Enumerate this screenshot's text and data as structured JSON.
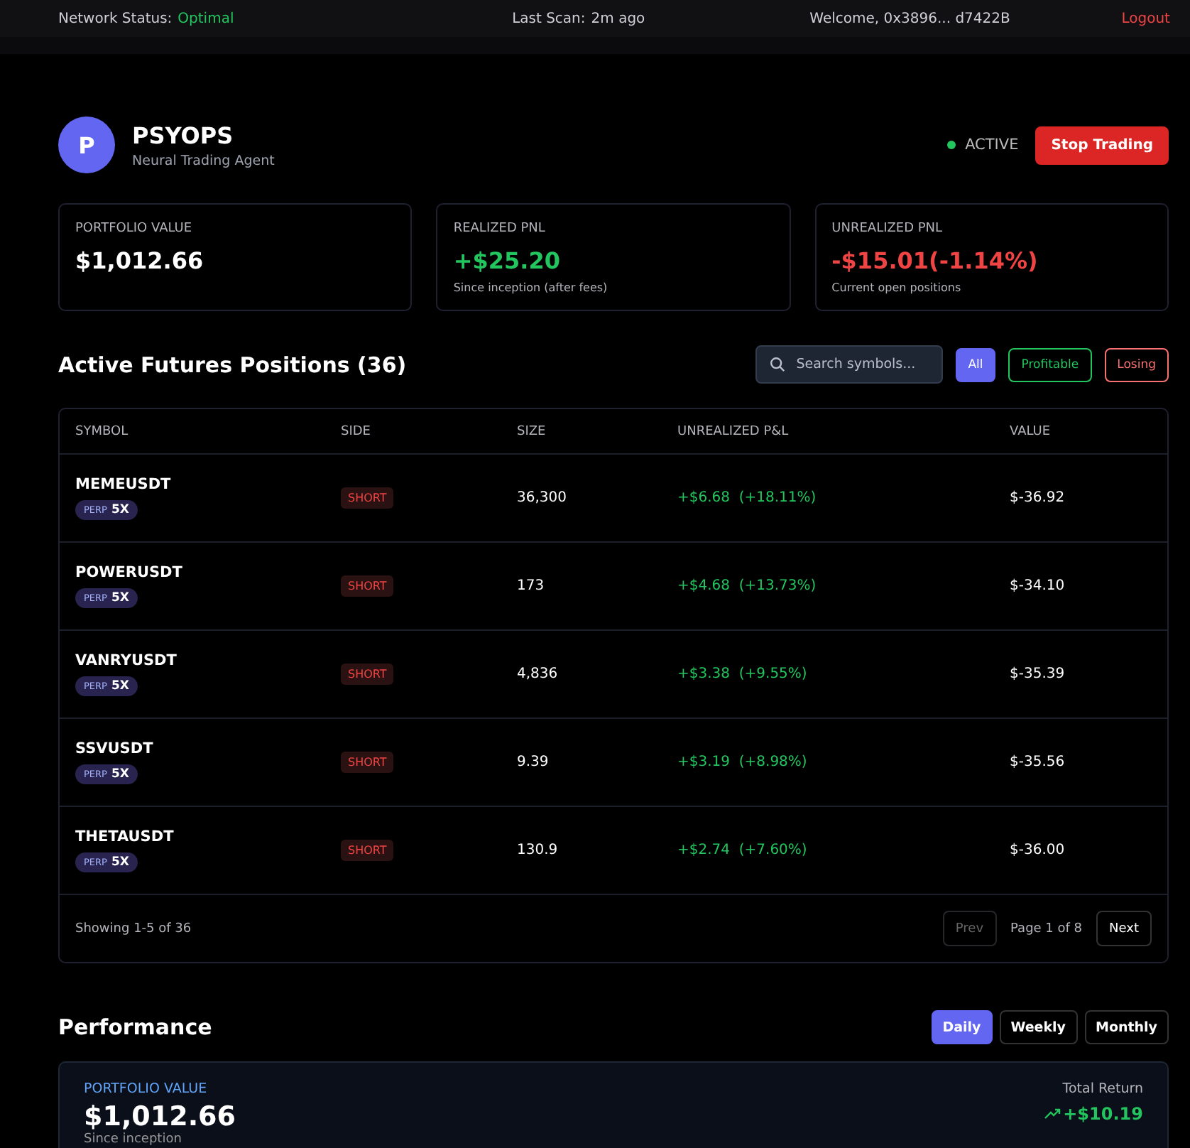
{
  "status_bar": {
    "network_label": "Network Status:",
    "network_value": "Optimal",
    "scan_label": "Last Scan:",
    "scan_value": "2m ago",
    "welcome": "Welcome, 0x3896... d7422B",
    "logout": "Logout"
  },
  "agent": {
    "initial": "P",
    "name": "PSYOPS",
    "subtitle": "Neural Trading Agent",
    "status": "ACTIVE",
    "active": true,
    "stop_button": "Stop Trading"
  },
  "stats": [
    {
      "label": "PORTFOLIO VALUE",
      "value": "$1,012.66",
      "kind": "neutral"
    },
    {
      "label": "REALIZED PNL",
      "value": "+$25.20",
      "note": "Since inception (after fees)",
      "kind": "positive"
    },
    {
      "label": "UNREALIZED PNL",
      "value": "-$15.01(-1.14%)",
      "note": "Current open positions",
      "kind": "negative"
    }
  ],
  "positions": {
    "title": "Active Futures Positions (36)",
    "search": {
      "placeholder": "Search symbols..."
    },
    "filters": [
      {
        "label": "All",
        "kind": "all",
        "selected": true
      },
      {
        "label": "Profitable",
        "kind": "positive",
        "selected": false
      },
      {
        "label": "Losing",
        "kind": "negative",
        "selected": false
      }
    ],
    "columns": [
      "SYMBOL",
      "SIDE",
      "SIZE",
      "UNREALIZED P&L",
      "VALUE"
    ],
    "rows": [
      {
        "symbol": "MEMEUSDT",
        "type": "PERP",
        "leverage": "5X",
        "side": "SHORT",
        "size": "36,300",
        "pnl": "+$6.68",
        "pnl_pct": "(+18.11%)",
        "value": "$-36.92"
      },
      {
        "symbol": "POWERUSDT",
        "type": "PERP",
        "leverage": "5X",
        "side": "SHORT",
        "size": "173",
        "pnl": "+$4.68",
        "pnl_pct": "(+13.73%)",
        "value": "$-34.10"
      },
      {
        "symbol": "VANRYUSDT",
        "type": "PERP",
        "leverage": "5X",
        "side": "SHORT",
        "size": "4,836",
        "pnl": "+$3.38",
        "pnl_pct": "(+9.55%)",
        "value": "$-35.39"
      },
      {
        "symbol": "SSVUSDT",
        "type": "PERP",
        "leverage": "5X",
        "side": "SHORT",
        "size": "9.39",
        "pnl": "+$3.19",
        "pnl_pct": "(+8.98%)",
        "value": "$-35.56"
      },
      {
        "symbol": "THETAUSDT",
        "type": "PERP",
        "leverage": "5X",
        "side": "SHORT",
        "size": "130.9",
        "pnl": "+$2.74",
        "pnl_pct": "(+7.60%)",
        "value": "$-36.00"
      }
    ],
    "showing": "Showing 1-5 of 36",
    "prev": {
      "label": "Prev",
      "disabled": true
    },
    "page": "Page 1 of 8",
    "next": {
      "label": "Next",
      "disabled": false
    }
  },
  "performance": {
    "title": "Performance",
    "tabs": [
      {
        "label": "Daily",
        "selected": true
      },
      {
        "label": "Weekly",
        "selected": false
      },
      {
        "label": "Monthly",
        "selected": false
      }
    ],
    "label": "PORTFOLIO VALUE",
    "value": "$1,012.66",
    "note": "Since inception",
    "return_label": "Total Return",
    "return_value": "+$10.19"
  }
}
